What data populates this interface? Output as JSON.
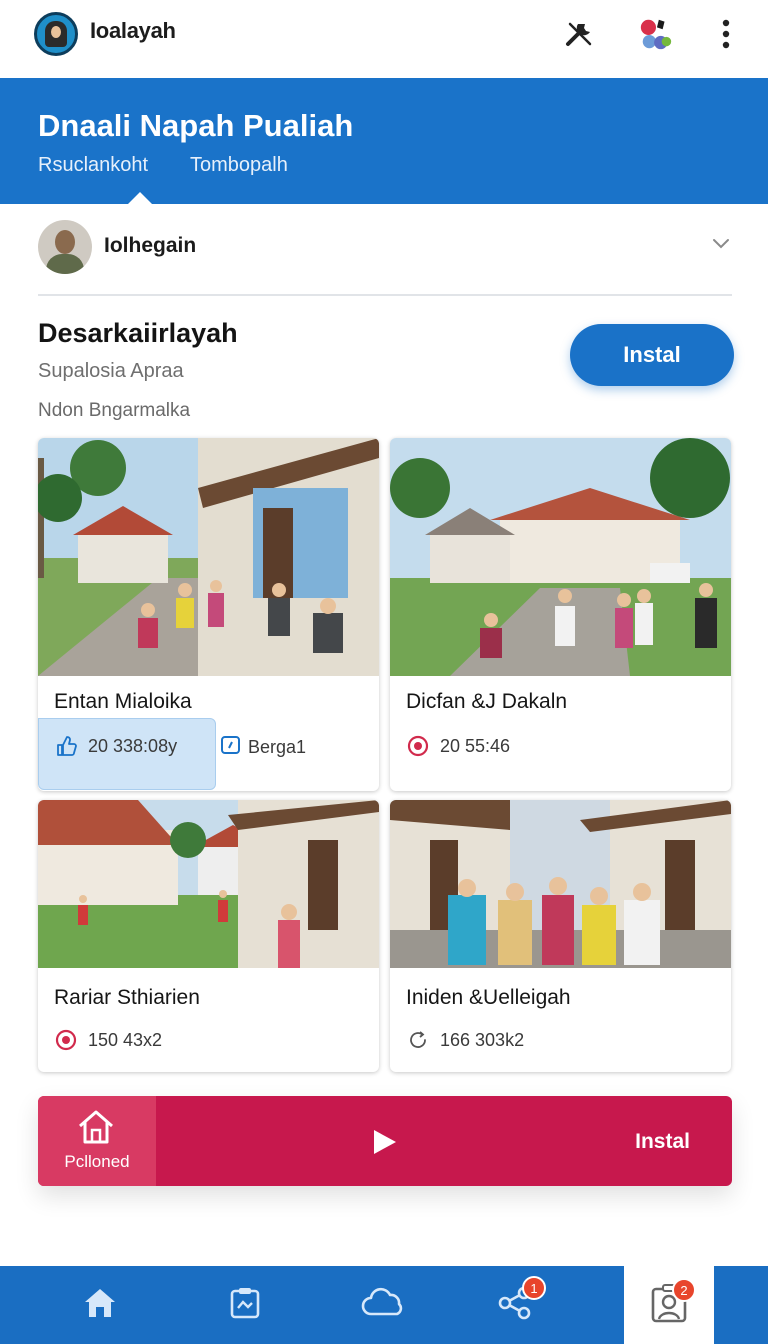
{
  "app": {
    "name": "Ioalayah"
  },
  "header": {
    "title": "Dnaali Napah Pualiah",
    "tabs": [
      "Rsuclankoht",
      "Tombopalh"
    ]
  },
  "profile": {
    "name": "Iolhegain"
  },
  "section": {
    "title": "Desarkaiirlayah",
    "subtitle": "Supalosia Apraa",
    "meta": "Ndon Bngarmalka",
    "install_label": "Instal"
  },
  "cards": [
    {
      "title": "Entan Mialoika",
      "stat": "20 338:08y",
      "stat_icon": "thumbs-up-icon",
      "extra": "Berga1",
      "extra_icon": "share-square-icon"
    },
    {
      "title": "Dicfan &J Dakaln",
      "stat": "20 55:46",
      "stat_icon": "target-icon"
    },
    {
      "title": "Rariar Sthiarien",
      "stat": "150 43x2",
      "stat_icon": "target-icon"
    },
    {
      "title": "Iniden &Uelleigah",
      "stat": "166 303k2",
      "stat_icon": "refresh-icon"
    }
  ],
  "banner": {
    "left_label": "Pclloned",
    "cta": "Instal"
  },
  "bottom_nav": {
    "items": [
      "home-icon",
      "clipboard-icon",
      "cloud-icon",
      "share-icon",
      "profile-card-icon"
    ],
    "badges": {
      "share": "1",
      "profile": "2"
    }
  },
  "colors": {
    "primary": "#1a73c9",
    "banner": "#c7184d",
    "badge": "#e8452c"
  }
}
